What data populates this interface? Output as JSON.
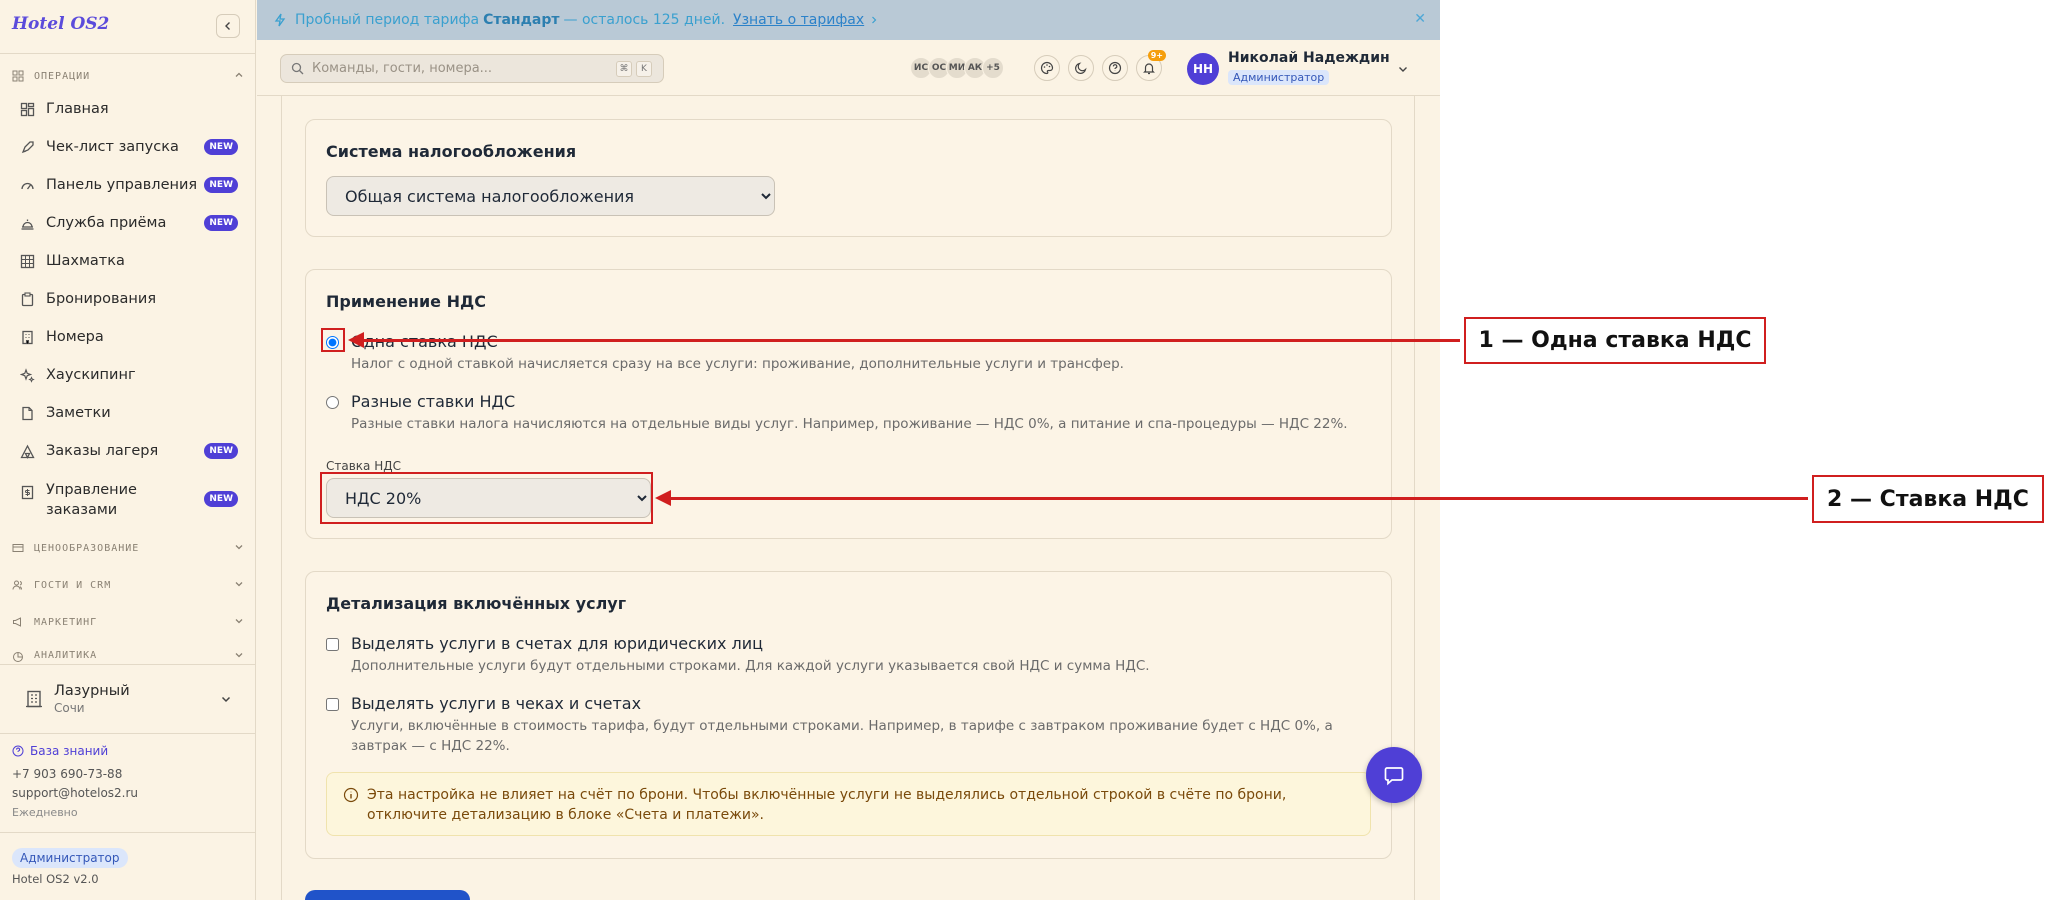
{
  "sidebar": {
    "brand": "Hotel OS2",
    "section_ops": "ОПЕРАЦИИ",
    "items": [
      {
        "label": "Главная",
        "badge": ""
      },
      {
        "label": "Чек-лист запуска",
        "badge": "NEW"
      },
      {
        "label": "Панель управления",
        "badge": "NEW"
      },
      {
        "label": "Служба приёма",
        "badge": "NEW"
      },
      {
        "label": "Шахматка",
        "badge": ""
      },
      {
        "label": "Бронирования",
        "badge": ""
      },
      {
        "label": "Номера",
        "badge": ""
      },
      {
        "label": "Хаускипинг",
        "badge": ""
      },
      {
        "label": "Заметки",
        "badge": ""
      },
      {
        "label": "Заказы лагеря",
        "badge": "NEW"
      },
      {
        "label": "Управление заказами",
        "badge": "NEW"
      }
    ],
    "sections": [
      "ЦЕНООБРАЗОВАНИЕ",
      "ГОСТИ И CRM",
      "МАРКЕТИНГ",
      "АНАЛИТИКА"
    ],
    "hotel": {
      "name": "Лазурный",
      "city": "Сочи"
    },
    "kb_link": "База знаний",
    "phone": "+7 903 690-73-88",
    "email": "support@hotelos2.ru",
    "schedule": "Ежедневно",
    "role": "Администратор",
    "version": "Hotel OS2 v2.0"
  },
  "banner": {
    "prefix": "Пробный период тарифа",
    "plan": "Стандарт",
    "suffix": "— осталось 125 дней.",
    "link": "Узнать о тарифах"
  },
  "topbar": {
    "search_placeholder": "Команды, гости, номера...",
    "kbd1": "⌘",
    "kbd2": "K",
    "avatars": [
      "ИС",
      "ОС",
      "МИ",
      "АК",
      "+5"
    ],
    "notif_count": "9+",
    "user_initials": "НН",
    "user_name": "Николай Надеждин",
    "user_role": "Администратор"
  },
  "tax": {
    "title": "Система налогообложения",
    "selected": "Общая система налогообложения"
  },
  "vat": {
    "title": "Применение НДС",
    "option1": {
      "label": "Одна ставка НДС",
      "desc": "Налог с одной ставкой начисляется сразу на все услуги: проживание, дополнительные услуги и трансфер.",
      "checked": true
    },
    "option2": {
      "label": "Разные ставки НДС",
      "desc": "Разные ставки налога начисляются на отдельные виды услуг. Например, проживание — НДС 0%, а питание и спа-процедуры — НДС 22%.",
      "checked": false
    },
    "rate_label": "Ставка НДС",
    "rate_selected": "НДС 20%"
  },
  "detail": {
    "title": "Детализация включённых услуг",
    "check1": {
      "label": "Выделять услуги в счетах для юридических лиц",
      "desc": "Дополнительные услуги будут отдельными строками. Для каждой услуги указывается свой НДС и сумма НДС."
    },
    "check2": {
      "label": "Выделять услуги в чеках и счетах",
      "desc": "Услуги, включённые в стоимость тарифа, будут отдельными строками. Например, в тарифе с завтраком проживание будет с НДС 0%, а завтрак — с НДС 22%."
    },
    "info": "Эта настройка не влияет на счёт по брони. Чтобы включённые услуги не выделялись отдельной строкой в счёте по брони, отключите детализацию в блоке «Счета и платежи»."
  },
  "annotations": {
    "a1": "1 — Одна ставка НДС",
    "a2": "2 — Ставка НДС"
  },
  "colors": {
    "accent": "#4f3fd6",
    "annotation": "#d01f1f",
    "banner_bg": "#b9c9d6",
    "page_bg": "#fbf3e4"
  }
}
